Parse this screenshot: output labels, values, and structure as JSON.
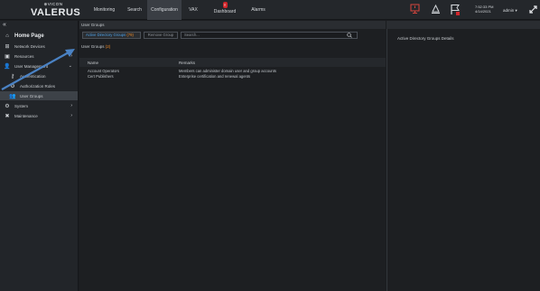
{
  "header": {
    "logo_small": "⊕VICON",
    "logo_big": "VALERUS",
    "nav": [
      {
        "label": "Monitoring"
      },
      {
        "label": "Search"
      },
      {
        "label": "Configuration"
      },
      {
        "label": "VAX"
      },
      {
        "label": "Dashboard",
        "alert": "!"
      },
      {
        "label": "Alarms"
      }
    ],
    "clock_time": "7:52:33 PM",
    "clock_date": "4/14/2021",
    "user": "admin ▾"
  },
  "sidebar": {
    "collapse": "«",
    "items": [
      {
        "label": "Home Page",
        "icon": "home-icon"
      },
      {
        "label": "Network Devices",
        "icon": "network-icon"
      },
      {
        "label": "Resources",
        "icon": "resources-icon"
      },
      {
        "label": "User Management",
        "icon": "user-icon"
      },
      {
        "label": "Authentication",
        "icon": "key-icon"
      },
      {
        "label": "Authorization Roles",
        "icon": "gear-icon"
      },
      {
        "label": "User Groups",
        "icon": "users-icon"
      },
      {
        "label": "System",
        "icon": "gear-icon"
      },
      {
        "label": "Maintenance",
        "icon": "tools-icon"
      }
    ]
  },
  "breadcrumb": "User Groups",
  "toolbar": {
    "tab_label": "Active Directory Groups",
    "tab_count": "(79)",
    "remove_label": "Remove Group",
    "search_placeholder": "Search..."
  },
  "groups": {
    "title": "User Groups",
    "count": "(2)"
  },
  "table": {
    "columns": [
      "Name",
      "Remarks"
    ],
    "rows": [
      {
        "name": "Account Operators",
        "remarks": "Members can administer domain user and group accounts"
      },
      {
        "name": "Cert Publishers",
        "remarks": "Enterprise certification and renewal agents"
      }
    ]
  },
  "details": {
    "title": "Active Directory Groups Details"
  },
  "colors": {
    "accent": "#4ea1e6",
    "count": "#f28c28",
    "alert": "#d0262b"
  }
}
